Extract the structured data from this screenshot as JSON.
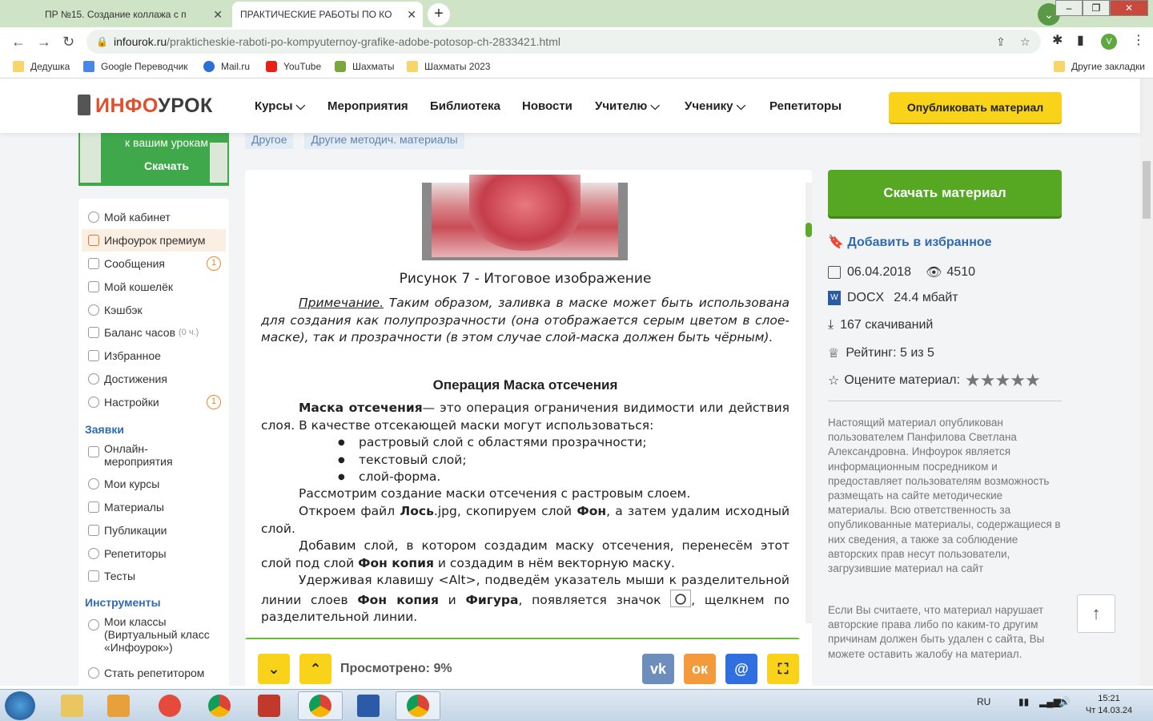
{
  "browser": {
    "tabs": [
      {
        "title": "",
        "active": false
      },
      {
        "title": "ПР №15. Создание коллажа с п",
        "active": false
      },
      {
        "title": "ПРАКТИЧЕСКИЕ РАБОТЫ ПО КО",
        "active": true
      }
    ],
    "url_host": "infourok.ru",
    "url_path": "/prakticheskie-raboti-po-kompyuternoy-grafike-adobe-potosop-ch-2833421.html",
    "profile_initial": "V",
    "bookmarks": [
      "Дедушка",
      "Google Переводчик",
      "Mail.ru",
      "YouTube",
      "Шахматы",
      "Шахматы 2023"
    ],
    "other_bookmarks": "Другие закладки"
  },
  "header": {
    "logo_part1": "ИНФО",
    "logo_part2": "УРОК",
    "nav": [
      "Курсы",
      "Мероприятия",
      "Библиотека",
      "Новости",
      "Учителю",
      "Ученику",
      "Репетиторы"
    ],
    "publish_label": "Опубликовать материал"
  },
  "promo": {
    "line1": "к вашим урокам",
    "button": "Скачать"
  },
  "sidebar": {
    "items": [
      {
        "label": "Мой кабинет"
      },
      {
        "label": "Инфоурок премиум"
      },
      {
        "label": "Сообщения",
        "badge": "1"
      },
      {
        "label": "Мой кошелёк"
      },
      {
        "label": "Кэшбэк"
      },
      {
        "label": "Баланс часов",
        "hint": "(0 ч.)"
      },
      {
        "label": "Избранное"
      },
      {
        "label": "Достижения"
      },
      {
        "label": "Настройки",
        "badge": "1"
      }
    ],
    "section_requests": "Заявки",
    "request_items": [
      "Онлайн-мероприятия",
      "Мои курсы",
      "Материалы",
      "Публикации",
      "Репетиторы",
      "Тесты"
    ],
    "section_tools": "Инструменты",
    "tool_items": [
      "Мои классы (Виртуальный класс «Инфоурок»)",
      "Стать репетитором"
    ]
  },
  "tags": [
    "Другое",
    "Другие методич. материалы"
  ],
  "document": {
    "caption": "Рисунок 7 - Итоговое изображение",
    "note_label": "Примечание.",
    "note_text": " Таким образом, заливка в маске может быть использована для создания как полупрозрачности (она отображается серым цветом в слое-маске), так и прозрачности (в этом случае слой-маска должен быть чёрным).",
    "op_title": "Операция Маска отсечения",
    "def_bold": "Маска отсечения",
    "def_text": "— это операция ограничения видимости или действия слоя. В качестве отсекающей маски могут использоваться:",
    "bullets": [
      "растровый слой с областями прозрачности;",
      "текстовый слой;",
      "слой-форма."
    ],
    "p1": "Рассмотрим создание маски отсечения с растровым слоем.",
    "p2_a": "Откроем файл ",
    "p2_b": "Лось",
    "p2_c": ".jpg, скопируем слой ",
    "p2_d": "Фон",
    "p2_e": ", а затем удалим исходный слой.",
    "p3_a": "Добавим слой, в котором создадим маску отсечения, перенесём этот слой под слой ",
    "p3_b": "Фон копия",
    "p3_c": " и создадим в нём векторную маску.",
    "p4_a": "Удерживая клавишу <Alt>, подведём указатель мыши к разделительной линии слоев ",
    "p4_b": "Фон копия",
    "p4_c": " и ",
    "p4_d": "Фигура",
    "p4_e": ", появляется значок ",
    "p4_f": ", щелкнем по разделительной линии."
  },
  "viewer": {
    "viewed_label": "Просмотрено: 9%",
    "progress_fraction": 0.99,
    "vk": "vk",
    "ok": "ок",
    "mail": "@"
  },
  "right_panel": {
    "download_label": "Скачать материал",
    "favorite_label": "Добавить в избранное",
    "date": "06.04.2018",
    "views": "4510",
    "format": "DOCX",
    "size": "24.4 мбайт",
    "downloads": "167 скачиваний",
    "rating": "Рейтинг: 5 из 5",
    "rate_label": "Оцените материал:",
    "stars": "★★★★★",
    "disclaimer1": "Настоящий материал опубликован пользователем Панфилова Светлана Александровна. Инфоурок является информационным посредником и предоставляет пользователям возможность размещать на сайте методические материалы. Всю ответственность за опубликованные материалы, содержащиеся в них сведения, а также за соблюдение авторских прав несут пользователи, загрузившие материал на сайт",
    "disclaimer2": "Если Вы считаете, что материал нарушает авторские права либо по каким-то другим причинам должен быть удален с сайта, Вы можете оставить жалобу на материал."
  },
  "taskbar": {
    "lang": "RU",
    "time": "15:21",
    "date": "Чт 14.03.24"
  },
  "colors": {
    "brand_green": "#56a823",
    "brand_yellow": "#f9d21a",
    "link_blue": "#2f6ab3",
    "accent_red": "#e24e2b"
  }
}
